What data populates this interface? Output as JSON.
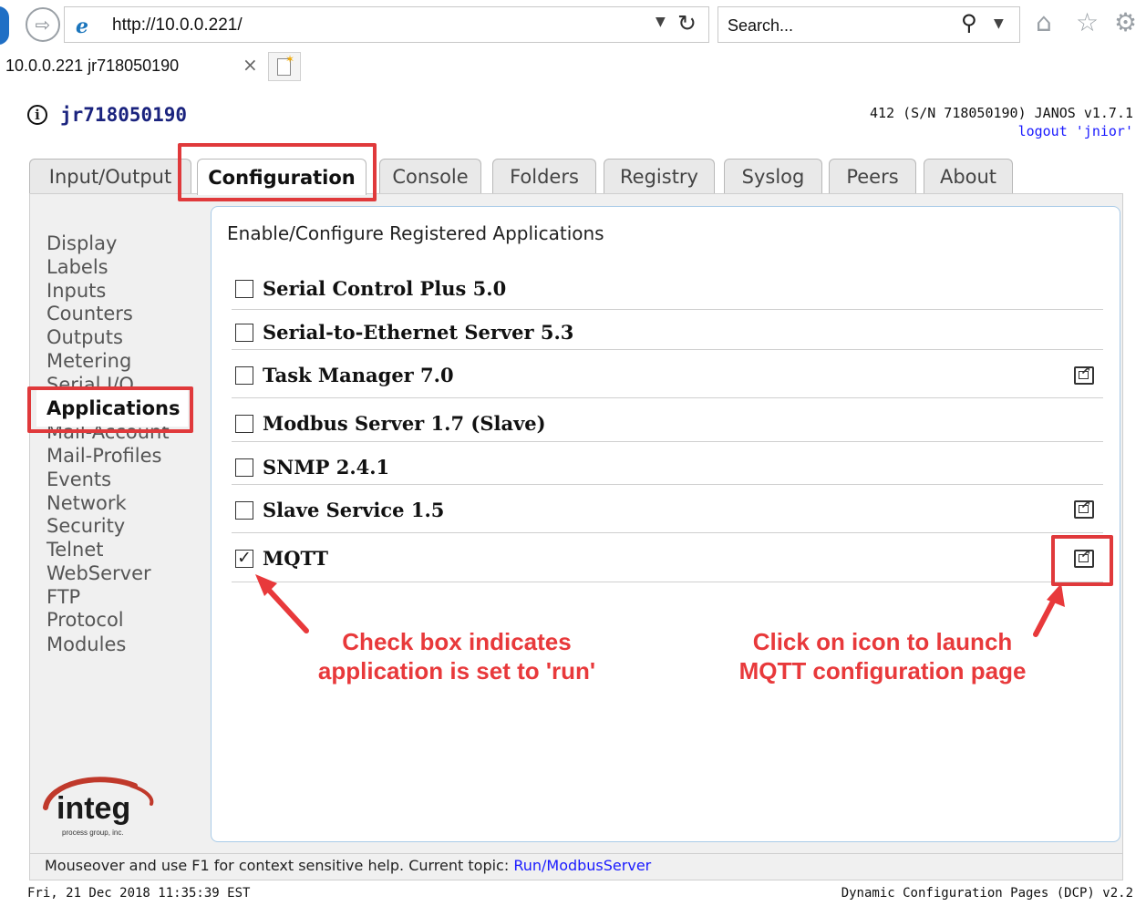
{
  "browser": {
    "url": "http://10.0.0.221/",
    "search_placeholder": "Search...",
    "tab_title": "10.0.0.221 jr718050190",
    "tab_close": "×",
    "icons": [
      "back-arrow-icon",
      "forward-arrow-icon",
      "ie-logo-icon",
      "dropdown-icon",
      "refresh-icon",
      "search-icon",
      "home-icon",
      "favorites-star-icon",
      "settings-gear-icon",
      "close-icon",
      "new-tab-icon"
    ]
  },
  "header": {
    "device_name": "jr718050190",
    "device_info": "412 (S/N 718050190) JANOS v1.7.1",
    "logout": "logout 'jnior'"
  },
  "tabs": [
    {
      "label": "Input/Output",
      "active": false
    },
    {
      "label": "Configuration",
      "active": true
    },
    {
      "label": "Console",
      "active": false
    },
    {
      "label": "Folders",
      "active": false
    },
    {
      "label": "Registry",
      "active": false
    },
    {
      "label": "Syslog",
      "active": false
    },
    {
      "label": "Peers",
      "active": false
    },
    {
      "label": "About",
      "active": false
    }
  ],
  "menu": [
    {
      "label": "Display"
    },
    {
      "label": "Labels"
    },
    {
      "label": "Inputs"
    },
    {
      "label": "Counters"
    },
    {
      "label": "Outputs"
    },
    {
      "label": "Metering"
    },
    {
      "label": "Serial I/O"
    },
    {
      "label": "Applications",
      "active": true
    },
    {
      "label": "Mail-Account"
    },
    {
      "label": "Mail-Profiles"
    },
    {
      "label": "Events"
    },
    {
      "label": "Network"
    },
    {
      "label": "Security"
    },
    {
      "label": "Telnet"
    },
    {
      "label": "WebServer"
    },
    {
      "label": "FTP"
    },
    {
      "label": "Protocol"
    },
    {
      "label": "Modules"
    }
  ],
  "content": {
    "heading": "Enable/Configure Registered Applications",
    "apps": [
      {
        "name": "Serial Control Plus 5.0",
        "checked": false,
        "launch_icon": false
      },
      {
        "name": "Serial-to-Ethernet Server 5.3",
        "checked": false,
        "launch_icon": false
      },
      {
        "name": "Task Manager 7.0",
        "checked": false,
        "launch_icon": true
      },
      {
        "name": "Modbus Server 1.7 (Slave)",
        "checked": false,
        "launch_icon": false
      },
      {
        "name": "SNMP 2.4.1",
        "checked": false,
        "launch_icon": false
      },
      {
        "name": "Slave Service 1.5",
        "checked": false,
        "launch_icon": true
      },
      {
        "name": "MQTT",
        "checked": true,
        "launch_icon": true
      }
    ],
    "checkmark": "✓"
  },
  "annotations": {
    "checkbox_note_line1": "Check box indicates",
    "checkbox_note_line2": "application is set to 'run'",
    "icon_note_line1": "Click on icon to launch",
    "icon_note_line2": "MQTT configuration page",
    "color": "#e8393b"
  },
  "logo": {
    "brand": "integ",
    "tagline": "process group, inc."
  },
  "footer": {
    "help_text": "Mouseover and use F1 for context sensitive help. Current topic: ",
    "help_topic": "Run/ModbusServer",
    "date_time": "Fri, 21 Dec 2018 11:35:39 EST",
    "dcp_version": "Dynamic Configuration Pages (DCP) v2.2"
  }
}
